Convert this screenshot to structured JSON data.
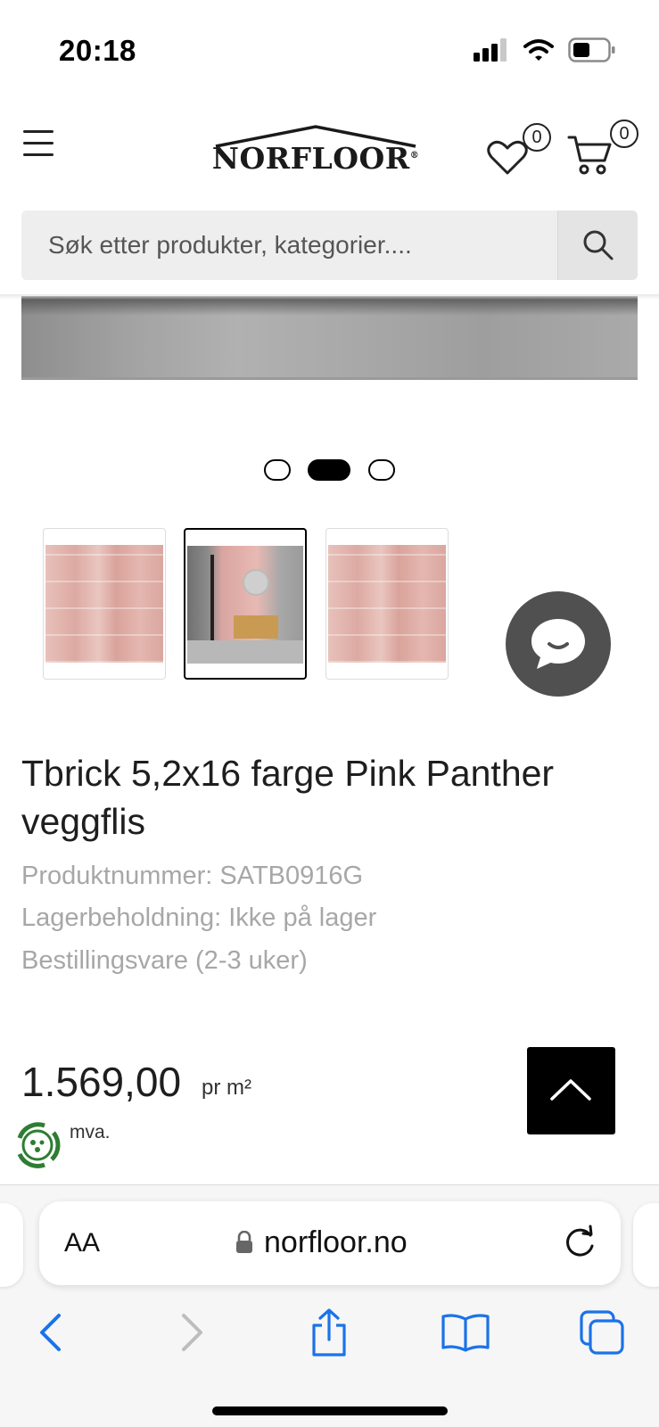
{
  "status": {
    "time": "20:18"
  },
  "header": {
    "logo_text": "NORFLOOR",
    "logo_mark": "®",
    "wishlist_count": "0",
    "cart_count": "0"
  },
  "search": {
    "placeholder": "Søk etter produkter, kategorier...."
  },
  "gallery": {
    "slide_count": 3,
    "active_slide": 2
  },
  "product": {
    "title": "Tbrick 5,2x16 farge Pink Panther veggflis",
    "product_number": "Produktnummer: SATB0916G",
    "stock": "Lagerbeholdning: Ikke på lager",
    "order_info": "Bestillingsvare (2-3 uker)",
    "price": "1.569,00",
    "price_unit": "pr m²",
    "vat": "mva."
  },
  "browser": {
    "text_size": "AA",
    "url": "norfloor.no"
  },
  "icons": {
    "menu": "hamburger-menu-icon",
    "wishlist": "heart-icon",
    "cart": "cart-icon",
    "search": "search-icon",
    "chat": "chat-bubble-icon",
    "scroll_top": "chevron-up-icon",
    "lock": "lock-icon",
    "reload": "reload-icon",
    "back": "back-arrow-icon",
    "forward": "forward-arrow-icon",
    "share": "share-icon",
    "bookmarks": "bookmarks-icon",
    "tabs": "tabs-icon"
  },
  "colors": {
    "ios_blue": "#1a73e8",
    "chat_bg": "#505050",
    "muted_text": "#a7a7a7"
  }
}
